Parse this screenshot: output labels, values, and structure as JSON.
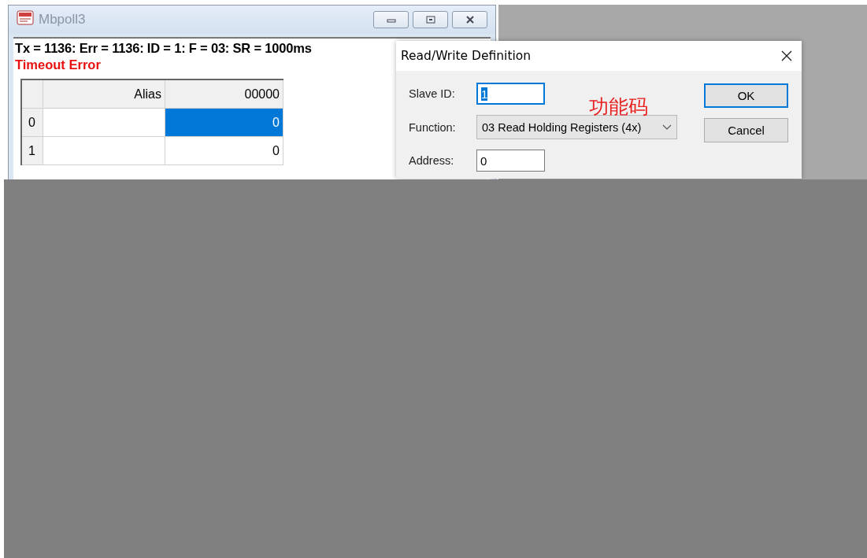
{
  "mbpoll_window": {
    "title": "Mbpoll3",
    "status_line": "Tx = 1136: Err = 1136: ID = 1: F = 03: SR = 1000ms",
    "error": "Timeout Error",
    "table": {
      "columns": [
        "Alias",
        "00000"
      ],
      "rows": [
        {
          "header": "0",
          "value": "0",
          "selected": true
        },
        {
          "header": "1",
          "value": "0",
          "selected": false
        }
      ]
    }
  },
  "dialog": {
    "title": "Read/Write Definition",
    "annotation": "功能码",
    "fields": [
      {
        "kind": "text",
        "label": "Slave ID:",
        "value": "1",
        "focused": true
      },
      {
        "kind": "select",
        "label": "Function:",
        "value": "03 Read Holding Registers (4x)"
      },
      {
        "kind": "text",
        "label": "Address:",
        "value": "0",
        "focused": false
      }
    ],
    "buttons": [
      {
        "label": "OK",
        "default": true
      },
      {
        "label": "Cancel",
        "default": false
      }
    ]
  }
}
